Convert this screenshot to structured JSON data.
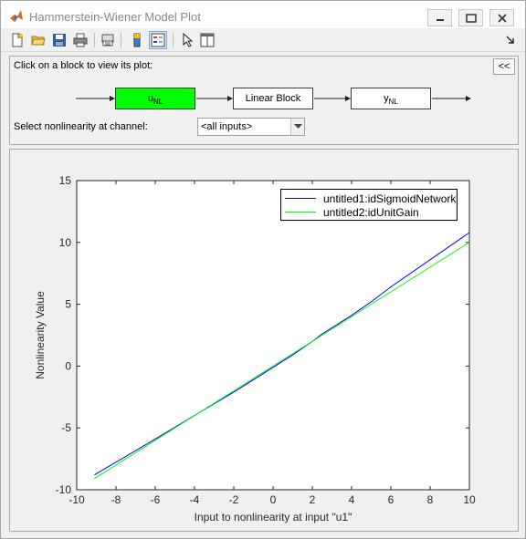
{
  "window": {
    "title": "Hammerstein-Wiener Model Plot"
  },
  "toolbar": {
    "buttons": [
      "new-file-icon",
      "open-folder-icon",
      "save-icon",
      "print-icon",
      "print-preview-icon",
      "colorbar-icon",
      "legend-icon",
      "pointer-icon",
      "property-editor-icon"
    ]
  },
  "block_panel": {
    "hint": "Click on a block to view its plot:",
    "collapse_label": "<<",
    "blocks": {
      "input_nl_main": "u",
      "input_nl_sub": "NL",
      "linear": "Linear Block",
      "output_nl_main": "y",
      "output_nl_sub": "NL"
    },
    "channel_label": "Select nonlinearity at channel:",
    "channel_value": "<all inputs>"
  },
  "colors": {
    "active_block": "#00ff00",
    "series1": "#0000ff",
    "series2": "#00ff00"
  },
  "chart_data": {
    "type": "line",
    "xlabel": "Input to nonlinearity at input \"u1\"",
    "ylabel": "Nonlinearity Value",
    "xlim": [
      -10,
      10
    ],
    "ylim": [
      -10,
      15
    ],
    "xticks": [
      "-10",
      "-8",
      "-6",
      "-4",
      "-2",
      "0",
      "2",
      "4",
      "6",
      "8",
      "10"
    ],
    "yticks": [
      "-10",
      "-5",
      "0",
      "5",
      "10",
      "15"
    ],
    "legend_position": "top-right",
    "series": [
      {
        "name": "untitled1:idSigmoidNetwork",
        "color": "#0000ff",
        "x": [
          -9.1,
          -6,
          -4,
          -2,
          0,
          1,
          2,
          2.5,
          3,
          3.5,
          4,
          5,
          6,
          8,
          10
        ],
        "y": [
          -8.8,
          -5.9,
          -4.0,
          -2.1,
          -0.1,
          0.9,
          2.0,
          2.6,
          3.1,
          3.6,
          4.1,
          5.2,
          6.4,
          8.6,
          10.8
        ]
      },
      {
        "name": "untitled2:idUnitGain",
        "color": "#00ff00",
        "x": [
          -9.1,
          10
        ],
        "y": [
          -9.1,
          10
        ]
      }
    ]
  }
}
